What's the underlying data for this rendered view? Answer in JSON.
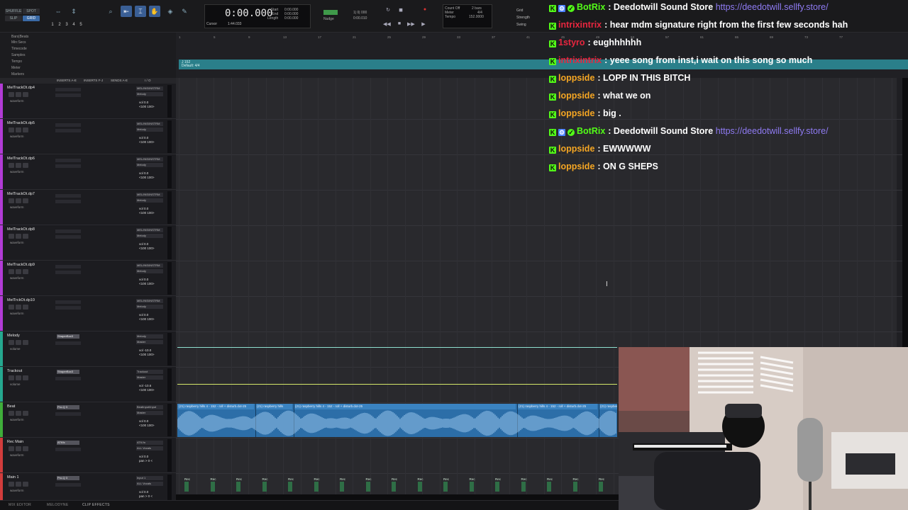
{
  "toolbar": {
    "modes": [
      "SHUFFLE",
      "SPOT",
      "SLIP",
      "GRID"
    ],
    "numbers": [
      "1",
      "2",
      "3",
      "4",
      "5"
    ],
    "counter": "0:00.000",
    "cursor_label": "Cursor",
    "cursor_value": "1:44.033",
    "selection_labels": [
      "Start",
      "End",
      "Length"
    ],
    "selection_values": [
      "0:00.000",
      "0:00.000",
      "0:00.000"
    ],
    "nudge_label": "Nudge",
    "nudge_values": [
      "1| 0| 000",
      "0:00.010"
    ],
    "tempo_lines": [
      "Count Off",
      "Meter",
      "Tempo",
      "2 bars",
      "4/4",
      "152.0000"
    ],
    "grid_labels": [
      "Grid",
      "Strength",
      "Swing"
    ],
    "transport_icons": [
      "rewind-icon",
      "fast-forward-icon",
      "stop-icon",
      "play-icon",
      "record-icon"
    ]
  },
  "rulers": {
    "names": [
      "Bars|Beats",
      "Min:Secs",
      "Timecode",
      "Samples",
      "Tempo",
      "Meter",
      "Markers"
    ],
    "ticks": [
      "1",
      "5",
      "9",
      "13",
      "17",
      "21",
      "25",
      "29",
      "33",
      "37",
      "41",
      "45",
      "49",
      "53",
      "57",
      "61",
      "65",
      "69",
      "73",
      "77"
    ],
    "tempo_text": "J 152",
    "meter_text": "Default: 4/4"
  },
  "columns": [
    "INSERTS A-E",
    "INSERTS F-J",
    "SENDS A-E",
    "I / O"
  ],
  "tracks": [
    {
      "name": "MelTrackOt.dp4",
      "color": "#b23bd6",
      "output": "MEL/INS/INSTRM",
      "dest": "Melody",
      "vol": "vol 0.0",
      "pan": "<100 100>",
      "view": "waveform",
      "plugin": ""
    },
    {
      "name": "MelTrackOt.dp5",
      "color": "#b23bd6",
      "output": "MEL/INS/INSTRM",
      "dest": "Melody",
      "vol": "vol 0.0",
      "pan": "<100 100>",
      "view": "waveform",
      "plugin": ""
    },
    {
      "name": "MelTrackOt.dp6",
      "color": "#b23bd6",
      "output": "MEL/INS/INSTRM",
      "dest": "Melody",
      "vol": "vol 0.0",
      "pan": "<100 100>",
      "view": "waveform",
      "plugin": ""
    },
    {
      "name": "MelTrackOt.dp7",
      "color": "#b23bd6",
      "output": "MEL/INS/INSTRM",
      "dest": "Melody",
      "vol": "vol 0.0",
      "pan": "<100 100>",
      "view": "waveform",
      "plugin": ""
    },
    {
      "name": "MelTrackOt.dp8",
      "color": "#b23bd6",
      "output": "MEL/INS/INSTRM",
      "dest": "Melody",
      "vol": "vol 0.0",
      "pan": "<100 100>",
      "view": "waveform",
      "plugin": ""
    },
    {
      "name": "MelTrackOt.dp9",
      "color": "#b23bd6",
      "output": "MEL/INS/INSTRM",
      "dest": "Melody",
      "vol": "vol 0.0",
      "pan": "<100 100>",
      "view": "waveform",
      "plugin": ""
    },
    {
      "name": "MelTrckOt.dp10",
      "color": "#b23bd6",
      "output": "MEL/INS/INSTRM",
      "dest": "Melody",
      "vol": "vol 0.0",
      "pan": "<100 100>",
      "view": "waveform",
      "plugin": ""
    },
    {
      "name": "Melody",
      "color": "#25a88f",
      "output": "Melody",
      "dest": "Master",
      "vol": "vol -10.0",
      "pan": "<100 100>",
      "view": "volume",
      "plugin": "ShaperBox3"
    },
    {
      "name": "Trackout",
      "color": "#25a88f",
      "output": "Trackout",
      "dest": "Master",
      "vol": "vol -10.6",
      "pan": "<100 100>",
      "view": "volume",
      "plugin": "ShaperBox3"
    },
    {
      "name": "Beat",
      "color": "#3fae3a",
      "output": "BeatInput/Input",
      "dest": "Master",
      "vol": "vol 0.0",
      "pan": "<100 100>",
      "view": "waveform",
      "plugin": "Pro-Q 3"
    },
    {
      "name": "Rec Main",
      "color": "#d23c3c",
      "output": "ATK/In",
      "dest": "ALL Vocals",
      "vol": "vol 0.0",
      "pan": "pan > 0 <",
      "view": "waveform",
      "plugin": "ATKfx"
    },
    {
      "name": "Main 1",
      "color": "#d23c3c",
      "output": "Input 1",
      "dest": "ALL Vocals",
      "vol": "vol 0.0",
      "pan": "pan > 0 <",
      "view": "waveform",
      "plugin": "Pro-Q 3"
    }
  ],
  "clips": [
    "(21) raspberry hills 4 - 152 - roll + disturb.dot-25",
    "(21) raspberry hills",
    "(21) raspberry hills 4 - 152 - roll + disturb.dot-25",
    "(21) raspberry hills 4 - 152 - roll + disturb.dot-25",
    "(21) raspberr"
  ],
  "rec_markers": [
    "Rec",
    "Rec",
    "Rec",
    "Rec",
    "Rec",
    "Rec",
    "Rec",
    "Rec",
    "Rec",
    "Rec",
    "Rec",
    "Rec",
    "Rec",
    "Rec",
    "Rec",
    "Rec",
    "Rec"
  ],
  "bottom_tabs": [
    "MIX EDITOR",
    "MELODYNE",
    "CLIP EFFECTS"
  ],
  "chat": [
    {
      "user": "BotRix",
      "user_color": "#53fc18",
      "text": "Deedotwill Sound Store",
      "link": "https://deedotwill.sellfy.store/",
      "badges": [
        "kick-badge-icon",
        "bot-badge-icon",
        "verified-badge-icon"
      ]
    },
    {
      "user": "intrixintrix",
      "user_color": "#e8263f",
      "text": "hear mdm signature right from the first few seconds hah",
      "link": "",
      "badges": [
        "kick-badge-icon"
      ]
    },
    {
      "user": "1styro",
      "user_color": "#e8263f",
      "text": "eughhhhhh",
      "link": "",
      "badges": [
        "kick-badge-icon"
      ]
    },
    {
      "user": "intrixintrix",
      "user_color": "#e8263f",
      "text": "yeee song from inst,i wait on this song so much",
      "link": "",
      "badges": [
        "kick-badge-icon"
      ]
    },
    {
      "user": "loppside",
      "user_color": "#f5a623",
      "text": "LOPP IN THIS BITCH",
      "link": "",
      "badges": [
        "kick-badge-icon"
      ]
    },
    {
      "user": "loppside",
      "user_color": "#f5a623",
      "text": "what we on",
      "link": "",
      "badges": [
        "kick-badge-icon"
      ]
    },
    {
      "user": "loppside",
      "user_color": "#f5a623",
      "text": "big .",
      "link": "",
      "badges": [
        "kick-badge-icon"
      ]
    },
    {
      "user": "BotRix",
      "user_color": "#53fc18",
      "text": "Deedotwill Sound Store",
      "link": "https://deedotwill.sellfy.store/",
      "badges": [
        "kick-badge-icon",
        "bot-badge-icon",
        "verified-badge-icon"
      ]
    },
    {
      "user": "loppside",
      "user_color": "#f5a623",
      "text": "EWWWWW",
      "link": "",
      "badges": [
        "kick-badge-icon"
      ]
    },
    {
      "user": "loppside",
      "user_color": "#f5a623",
      "text": "ON G SHEPS",
      "link": "",
      "badges": [
        "kick-badge-icon"
      ]
    }
  ]
}
